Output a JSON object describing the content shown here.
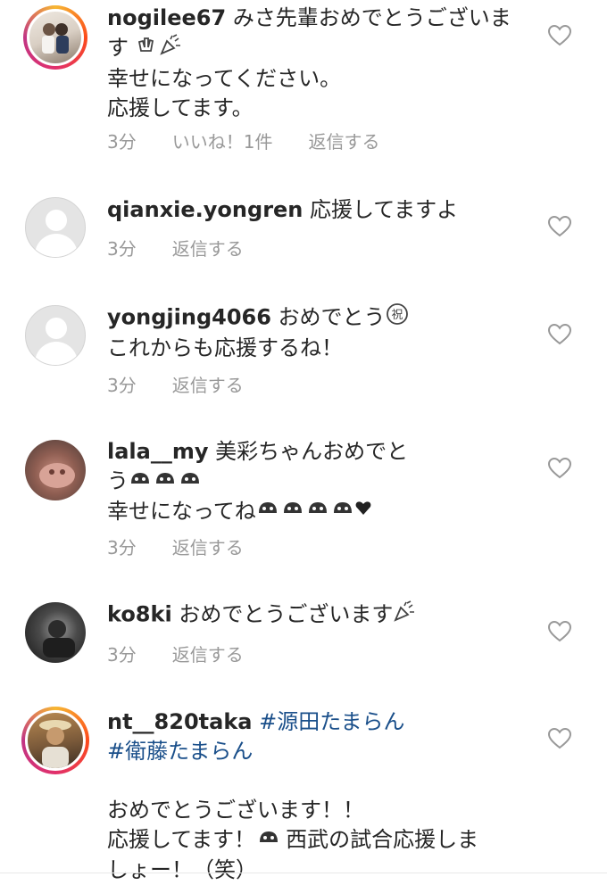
{
  "comments": [
    {
      "user": "nogilee67",
      "lines": [
        "みさ先輩おめでとうございま",
        "す",
        "幸せになってください。",
        "応援してます。"
      ],
      "time": "3分",
      "likes": "いいね！1件",
      "reply": "返信する",
      "avatar": "photo-ring"
    },
    {
      "user": "qianxie.yongren",
      "lines": [
        "応援してますよ"
      ],
      "time": "3分",
      "reply": "返信する",
      "avatar": "default"
    },
    {
      "user": "yongjing4066",
      "lines": [
        "おめでとう",
        "これからも応援するね！"
      ],
      "time": "3分",
      "reply": "返信する",
      "avatar": "default"
    },
    {
      "user": "lala__my",
      "lines": [
        "美彩ちゃんおめでと",
        "う",
        "幸せになってね"
      ],
      "time": "3分",
      "reply": "返信する",
      "avatar": "photo"
    },
    {
      "user": "ko8ki",
      "lines": [
        "おめでとうございます"
      ],
      "time": "3分",
      "reply": "返信する",
      "avatar": "photo"
    },
    {
      "user": "nt__820taka",
      "hashtags": [
        "#源田たまらん",
        "#衛藤たまらん"
      ],
      "lines": [
        "おめでとうございます！！",
        "応援してます！",
        "西武の試合応援しま",
        "しょー！（笑）"
      ],
      "avatar": "photo-ring"
    }
  ],
  "colors": {
    "username": "#262626",
    "meta": "#999999",
    "hashtag": "#1a4f8a"
  }
}
